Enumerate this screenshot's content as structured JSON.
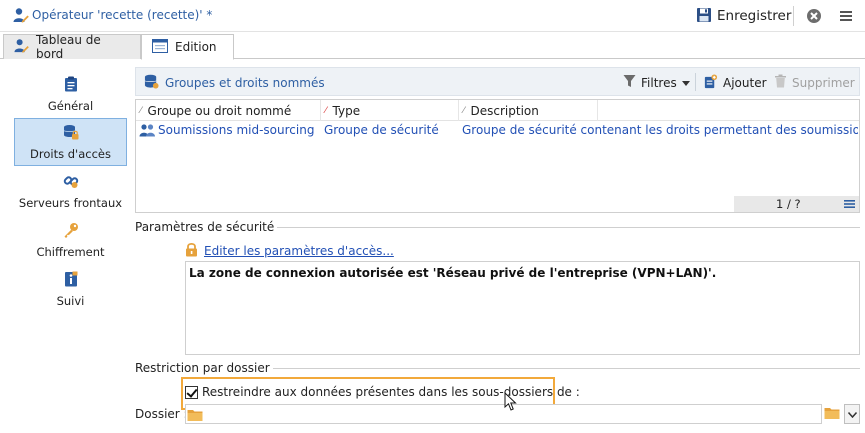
{
  "window": {
    "title": "Opérateur 'recette (recette)' *",
    "save_label": "Enregistrer"
  },
  "tabs": [
    {
      "label": "Tableau de bord",
      "active": false
    },
    {
      "label": "Edition",
      "active": true
    }
  ],
  "leftnav": {
    "items": [
      {
        "label": "Général",
        "icon": "clipboard-icon",
        "selected": false
      },
      {
        "label": "Droits d'accès",
        "icon": "database-lock-icon",
        "selected": true
      },
      {
        "label": "Serveurs frontaux",
        "icon": "link-icon",
        "selected": false
      },
      {
        "label": "Chiffrement",
        "icon": "key-icon",
        "selected": false
      },
      {
        "label": "Suivi",
        "icon": "info-doc-icon",
        "selected": false
      }
    ]
  },
  "groups": {
    "title": "Groupes et droits nommés",
    "filters_label": "Filtres",
    "add_label": "Ajouter",
    "delete_label": "Supprimer",
    "columns": [
      "Groupe ou droit nommé",
      "Type",
      "Description"
    ],
    "rows": [
      {
        "name": "Soumissions mid-sourcing",
        "type": "Groupe de sécurité",
        "description": "Groupe de sécurité contenant les droits permettant des soumissions de diff..."
      }
    ],
    "pagination": "1 / ?"
  },
  "security": {
    "section_title": "Paramètres de sécurité",
    "edit_link": "Editer les paramètres d'accès...",
    "info_text": "La zone de connexion autorisée est 'Réseau privé de l'entreprise (VPN+LAN)'."
  },
  "restriction": {
    "section_title": "Restriction par dossier",
    "checkbox_label": "Restreindre aux données présentes dans les sous-dossiers de :",
    "checkbox_checked": true,
    "dossier_label": "Dossier :",
    "dossier_value": ""
  },
  "colors": {
    "accent_blue": "#2e5fa3",
    "link_blue": "#2250b5",
    "highlight_orange": "#f2a93b",
    "selected_bg": "#cfe3f6"
  }
}
